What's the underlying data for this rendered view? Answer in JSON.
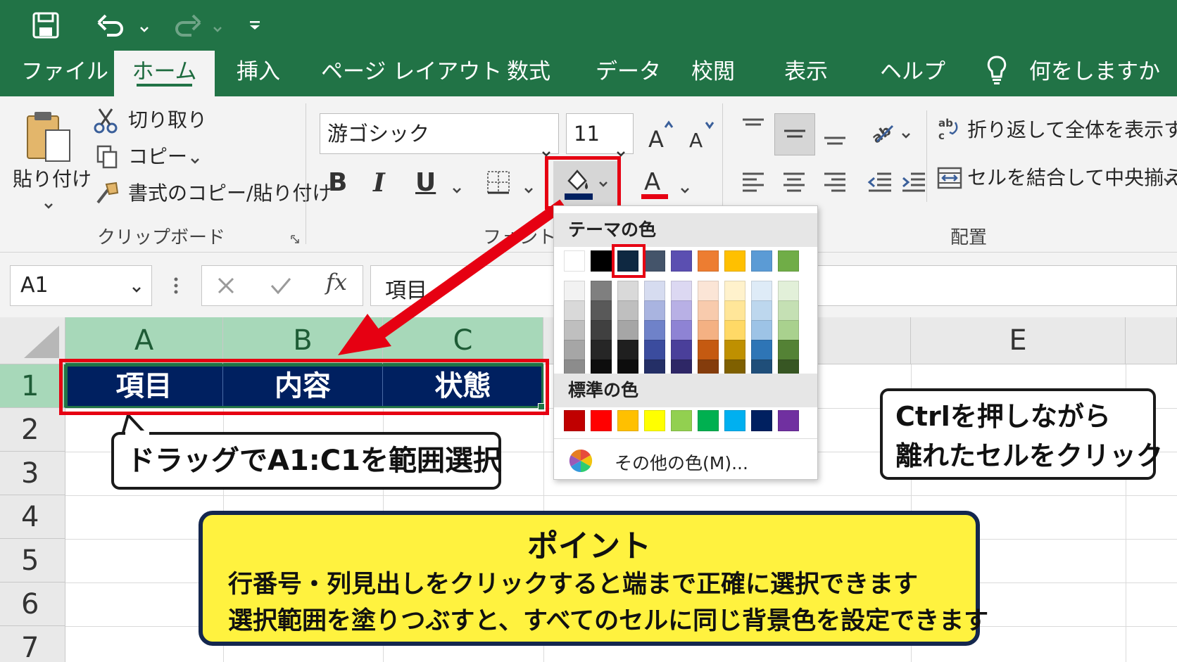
{
  "tabs": [
    {
      "label": "ファイル"
    },
    {
      "label": "ホーム"
    },
    {
      "label": "挿入"
    },
    {
      "label": "ページ レイアウト"
    },
    {
      "label": "数式"
    },
    {
      "label": "データ"
    },
    {
      "label": "校閲"
    },
    {
      "label": "表示"
    },
    {
      "label": "ヘルプ"
    }
  ],
  "tell_me": "何をしますか",
  "clipboard": {
    "paste": "貼り付け",
    "cut": "切り取り",
    "copy": "コピー",
    "format_painter": "書式のコピー/貼り付け",
    "group": "クリップボード"
  },
  "font": {
    "name": "游ゴシック",
    "size": "11",
    "group": "フォント"
  },
  "alignment": {
    "wrap": "折り返して全体を表示する",
    "merge": "セルを結合して中央揃え",
    "group": "配置"
  },
  "formula_bar": {
    "name_box": "A1",
    "fx": "fx",
    "value": "項目"
  },
  "columns": [
    "A",
    "B",
    "C",
    "E"
  ],
  "rows": [
    "1",
    "2",
    "3",
    "4",
    "5",
    "6",
    "7"
  ],
  "cells": {
    "a1": "項目",
    "b1": "内容",
    "c1": "状態"
  },
  "palette": {
    "theme_title": "テーマの色",
    "standard_title": "標準の色",
    "more_colors": "その他の色(M)...",
    "theme_top": [
      "#ffffff",
      "#000000",
      "#0e2841",
      "#44546a",
      "#5b4fb1",
      "#ed7d31",
      "#ffc000",
      "#5b9bd5",
      "#70ad47"
    ],
    "theme_shades": [
      [
        "#f2f2f2",
        "#d9d9d9",
        "#bfbfbf",
        "#a6a6a6",
        "#8c8c8c"
      ],
      [
        "#7f7f7f",
        "#595959",
        "#404040",
        "#262626",
        "#0d0d0d"
      ],
      [
        "#d9d9d9",
        "#bfbfbf",
        "#a6a6a6",
        "#1f1f1f",
        "#0d0d0d"
      ],
      [
        "#d6dcf0",
        "#a9b4e0",
        "#6f82c9",
        "#3b4c9e",
        "#242f66"
      ],
      [
        "#dcd8f2",
        "#b8b0e5",
        "#8e83d4",
        "#4a3f9a",
        "#2e2766"
      ],
      [
        "#fbe5d6",
        "#f8cbad",
        "#f4b183",
        "#c55a11",
        "#843c0c"
      ],
      [
        "#fff2cc",
        "#ffe699",
        "#ffd966",
        "#bf9000",
        "#7f6000"
      ],
      [
        "#deebf7",
        "#bdd7ee",
        "#9dc3e6",
        "#2e75b6",
        "#1f4e79"
      ],
      [
        "#e2f0d9",
        "#c5e0b4",
        "#a9d18e",
        "#548235",
        "#375623"
      ]
    ],
    "standard": [
      "#c00000",
      "#ff0000",
      "#ffc000",
      "#ffff00",
      "#92d050",
      "#00b050",
      "#00b0f0",
      "#002060",
      "#7030a0"
    ]
  },
  "callouts": {
    "drag": "ドラッグでA1:C1を範囲選択",
    "ctrl_line1": "Ctrlを押しながら",
    "ctrl_line2": "離れたセルをクリック"
  },
  "point": {
    "title": "ポイント",
    "line1": "行番号・列見出しをクリックすると端まで正確に選択できます",
    "line2": "選択範囲を塗りつぶすと、すべてのセルに同じ背景色を設定できます"
  },
  "colors": {
    "excel_green": "#217346",
    "navy_fill": "#002060",
    "highlight_red": "#e60012",
    "point_yellow": "#fff23f"
  }
}
